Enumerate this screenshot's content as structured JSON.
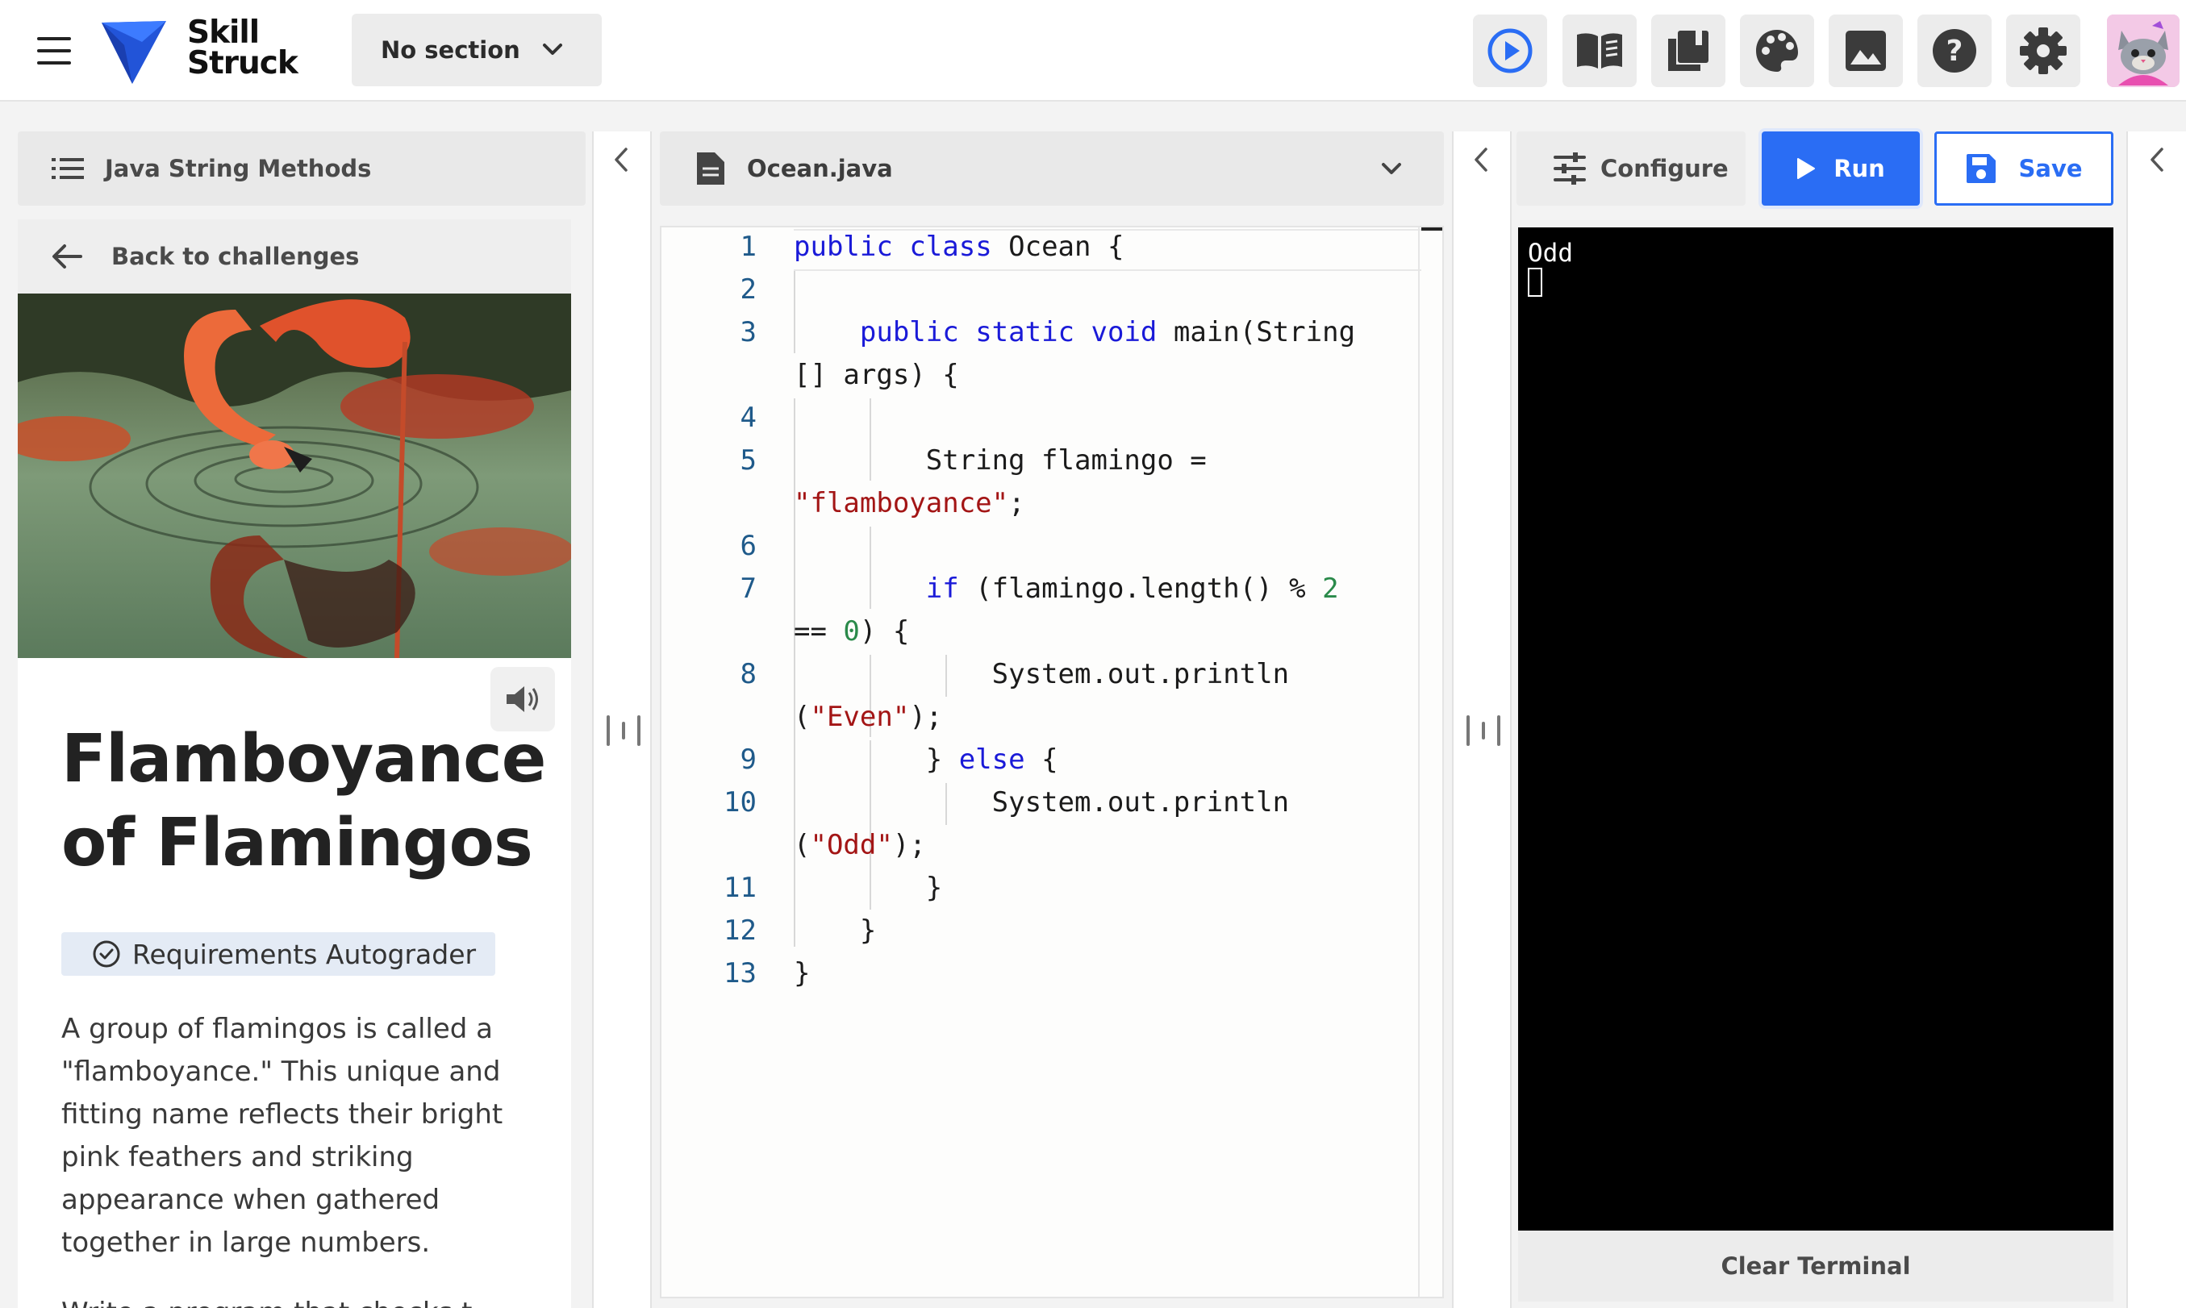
{
  "topbar": {
    "brand_line1": "Skill",
    "brand_line2": "Struck",
    "section_select": "No section",
    "icons": [
      "play-circle-icon",
      "book-open-icon",
      "library-icon",
      "palette-icon",
      "image-icon",
      "help-icon",
      "settings-icon"
    ],
    "accent": "#2a6df4"
  },
  "lesson": {
    "header": "Java String Methods",
    "back": "Back to challenges",
    "title_line1": "Flamboyance",
    "title_line2": "of Flamingos",
    "badge": "Requirements Autograder",
    "description": "A group of flamingos is called a \"flamboyance.\" This unique and fitting name reflects their bright pink feathers and striking appearance when gathered together in large numbers.",
    "description_more": "Write a program that checks t"
  },
  "editor": {
    "filename": "Ocean.java",
    "line_numbers": [
      "1",
      "2",
      "3",
      "4",
      "5",
      "6",
      "7",
      "8",
      "9",
      "10",
      "11",
      "12",
      "13"
    ]
  },
  "actions": {
    "configure": "Configure",
    "run": "Run",
    "save": "Save",
    "clear_terminal": "Clear Terminal"
  },
  "terminal": {
    "output": "Odd"
  }
}
